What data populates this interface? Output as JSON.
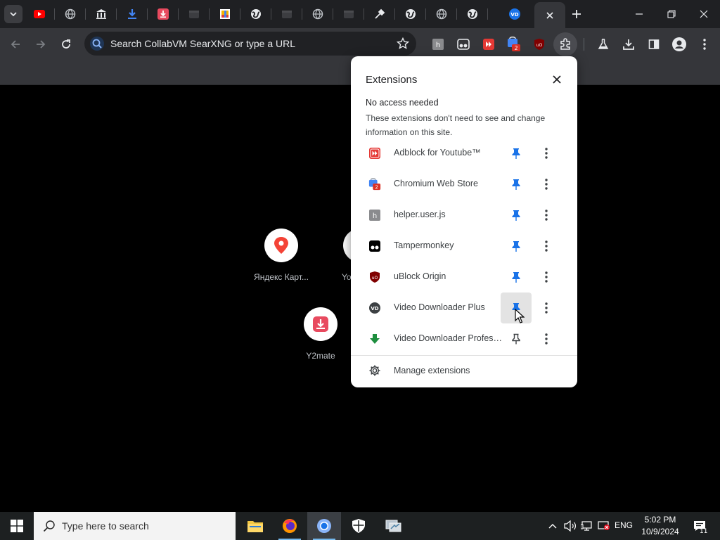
{
  "browser": {
    "omnibox_placeholder": "Search CollabVM SearXNG or type a URL",
    "accent": "#8ab4f8"
  },
  "tabs": [
    {
      "icon": "youtube-icon"
    },
    {
      "icon": "globe-icon"
    },
    {
      "icon": "bank-icon"
    },
    {
      "icon": "download-icon"
    },
    {
      "icon": "y2mate-icon"
    },
    {
      "icon": "blank-page-icon"
    },
    {
      "icon": "image-icon"
    },
    {
      "icon": "globe-icon"
    },
    {
      "icon": "blank-page-icon"
    },
    {
      "icon": "globe-icon"
    },
    {
      "icon": "blank-page-icon"
    },
    {
      "icon": "tools-icon"
    },
    {
      "icon": "globe-icon"
    },
    {
      "icon": "globe-icon"
    },
    {
      "icon": "globe-icon"
    },
    {
      "icon": "video-downloader-icon"
    },
    {
      "icon": "close-icon",
      "active": true
    }
  ],
  "toolbar_extensions": [
    {
      "icon": "helper-userjs-icon"
    },
    {
      "icon": "tampermonkey-icon"
    },
    {
      "icon": "adblock-youtube-icon"
    },
    {
      "icon": "chromium-web-store-icon",
      "badge": "2"
    },
    {
      "icon": "ublock-origin-icon"
    },
    {
      "icon": "extensions-puzzle-icon"
    }
  ],
  "shortcuts": [
    {
      "label": "Яндекс Карт...",
      "icon": "map-pin-icon"
    },
    {
      "label": "Yo",
      "icon": "partial-icon"
    },
    {
      "label": "Y2mate",
      "icon": "y2mate-download-icon"
    }
  ],
  "popup": {
    "title": "Extensions",
    "section_title": "No access needed",
    "section_desc": "These extensions don't need to see and change information on this site.",
    "extensions": [
      {
        "name": "Adblock for Youtube™",
        "icon": "adblock-youtube-icon",
        "pinned": true
      },
      {
        "name": "Chromium Web Store",
        "icon": "chromium-web-store-icon",
        "pinned": true,
        "badge": "2"
      },
      {
        "name": "helper.user.js",
        "icon": "helper-userjs-icon",
        "pinned": true
      },
      {
        "name": "Tampermonkey",
        "icon": "tampermonkey-icon",
        "pinned": true
      },
      {
        "name": "uBlock Origin",
        "icon": "ublock-origin-icon",
        "pinned": true
      },
      {
        "name": "Video Downloader Plus",
        "icon": "video-downloader-plus-icon",
        "pinned": true,
        "hovered": true
      },
      {
        "name": "Video Downloader Professi...",
        "icon": "video-downloader-pro-icon",
        "pinned": false
      }
    ],
    "manage_label": "Manage extensions"
  },
  "taskbar": {
    "search_placeholder": "Type here to search",
    "apps": [
      "file-explorer-icon",
      "firefox-icon",
      "chromium-icon",
      "security-shield-icon",
      "network-icon"
    ],
    "language": "ENG",
    "time": "5:02 PM",
    "date": "10/9/2024",
    "notification_count": "11"
  },
  "colors": {
    "pin_blue": "#1a73e8",
    "tab_strip": "#1f2023",
    "toolbar": "#35363a",
    "page_bg": "#000000",
    "popup_bg": "#ffffff"
  }
}
